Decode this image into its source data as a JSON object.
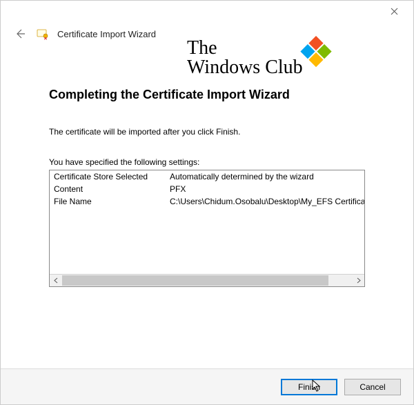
{
  "window": {
    "title": "Certificate Import Wizard"
  },
  "watermark": {
    "line1": "The",
    "line2": "Windows Club"
  },
  "page": {
    "heading": "Completing the Certificate Import Wizard",
    "description": "The certificate will be imported after you click Finish.",
    "settings_label": "You have specified the following settings:",
    "rows": [
      {
        "key": "Certificate Store Selected",
        "value": "Automatically determined by the wizard"
      },
      {
        "key": "Content",
        "value": "PFX"
      },
      {
        "key": "File Name",
        "value": "C:\\Users\\Chidum.Osobalu\\Desktop\\My_EFS Certificate_and_I"
      }
    ]
  },
  "buttons": {
    "finish": "Finish",
    "cancel": "Cancel"
  }
}
